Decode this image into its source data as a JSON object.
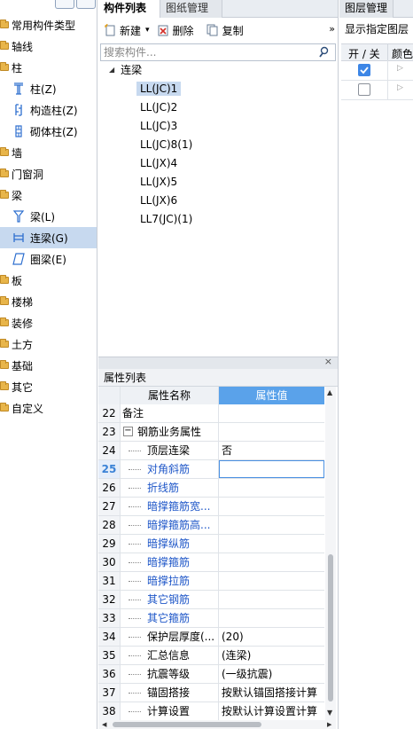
{
  "left_tree": {
    "items": [
      {
        "label": "常用构件类型",
        "kind": "folder"
      },
      {
        "label": "轴线",
        "kind": "folder"
      },
      {
        "label": "柱",
        "kind": "folder"
      },
      {
        "label": "柱(Z)",
        "kind": "child",
        "icon": "column-icon"
      },
      {
        "label": "构造柱(Z)",
        "kind": "child",
        "icon": "structural-column-icon"
      },
      {
        "label": "砌体柱(Z)",
        "kind": "child",
        "icon": "masonry-column-icon"
      },
      {
        "label": "墙",
        "kind": "folder"
      },
      {
        "label": "门窗洞",
        "kind": "folder"
      },
      {
        "label": "梁",
        "kind": "folder"
      },
      {
        "label": "梁(L)",
        "kind": "child",
        "icon": "beam-icon"
      },
      {
        "label": "连梁(G)",
        "kind": "child",
        "icon": "coupling-beam-icon",
        "selected": true
      },
      {
        "label": "圈梁(E)",
        "kind": "child",
        "icon": "ring-beam-icon"
      },
      {
        "label": "板",
        "kind": "folder"
      },
      {
        "label": "楼梯",
        "kind": "folder"
      },
      {
        "label": "装修",
        "kind": "folder"
      },
      {
        "label": "土方",
        "kind": "folder"
      },
      {
        "label": "基础",
        "kind": "folder"
      },
      {
        "label": "其它",
        "kind": "folder"
      },
      {
        "label": "自定义",
        "kind": "folder"
      }
    ]
  },
  "component_panel": {
    "tabs": [
      {
        "label": "构件列表",
        "active": true
      },
      {
        "label": "图纸管理",
        "active": false
      }
    ],
    "toolbar": {
      "new_label": "新建",
      "delete_label": "删除",
      "copy_label": "复制",
      "overflow": "»"
    },
    "search": {
      "placeholder": "搜索构件..."
    },
    "tree": {
      "root": "连梁",
      "items": [
        "LL(JC)1",
        "LL(JC)2",
        "LL(JC)3",
        "LL(JC)8(1)",
        "LL(JX)4",
        "LL(JX)5",
        "LL(JX)6",
        "LL7(JC)(1)"
      ],
      "selected_index": 0
    }
  },
  "property_panel": {
    "close": "×",
    "title": "属性列表",
    "col_name": "属性名称",
    "col_value": "属性值",
    "rows": [
      {
        "num": "22",
        "name": "备注",
        "value": "",
        "level": 0,
        "color": "black"
      },
      {
        "num": "23",
        "name": "钢筋业务属性",
        "value": "",
        "level": 0,
        "color": "black",
        "group": true,
        "toggle": "−"
      },
      {
        "num": "24",
        "name": "顶层连梁",
        "value": "否",
        "level": 1,
        "color": "black"
      },
      {
        "num": "25",
        "name": "对角斜筋",
        "value": "",
        "level": 1,
        "color": "blue",
        "active": true
      },
      {
        "num": "26",
        "name": "折线筋",
        "value": "",
        "level": 1,
        "color": "blue"
      },
      {
        "num": "27",
        "name": "暗撑箍筋宽...",
        "value": "",
        "level": 1,
        "color": "blue"
      },
      {
        "num": "28",
        "name": "暗撑箍筋高...",
        "value": "",
        "level": 1,
        "color": "blue"
      },
      {
        "num": "29",
        "name": "暗撑纵筋",
        "value": "",
        "level": 1,
        "color": "blue"
      },
      {
        "num": "30",
        "name": "暗撑箍筋",
        "value": "",
        "level": 1,
        "color": "blue"
      },
      {
        "num": "31",
        "name": "暗撑拉筋",
        "value": "",
        "level": 1,
        "color": "blue"
      },
      {
        "num": "32",
        "name": "其它钢筋",
        "value": "",
        "level": 1,
        "color": "blue"
      },
      {
        "num": "33",
        "name": "其它箍筋",
        "value": "",
        "level": 1,
        "color": "blue"
      },
      {
        "num": "34",
        "name": "保护层厚度(...",
        "value": "(20)",
        "level": 1,
        "color": "black"
      },
      {
        "num": "35",
        "name": "汇总信息",
        "value": "(连梁)",
        "level": 1,
        "color": "black"
      },
      {
        "num": "36",
        "name": "抗震等级",
        "value": "(一级抗震)",
        "level": 1,
        "color": "black"
      },
      {
        "num": "37",
        "name": "锚固搭接",
        "value": "按默认锚固搭接计算",
        "level": 1,
        "color": "black"
      },
      {
        "num": "38",
        "name": "计算设置",
        "value": "按默认计算设置计算",
        "level": 1,
        "color": "black"
      }
    ]
  },
  "layer_panel": {
    "title": "图层管理",
    "show_specified": "显示指定图层",
    "col_onoff": "开 / 关",
    "col_color": "颜色",
    "rows": [
      {
        "checked": true
      },
      {
        "checked": false
      }
    ]
  },
  "colors": {
    "selection": "#c7d9ef",
    "header_accent": "#5aa2ea",
    "link_blue": "#1f57c8",
    "folder": "#e8b54a"
  }
}
